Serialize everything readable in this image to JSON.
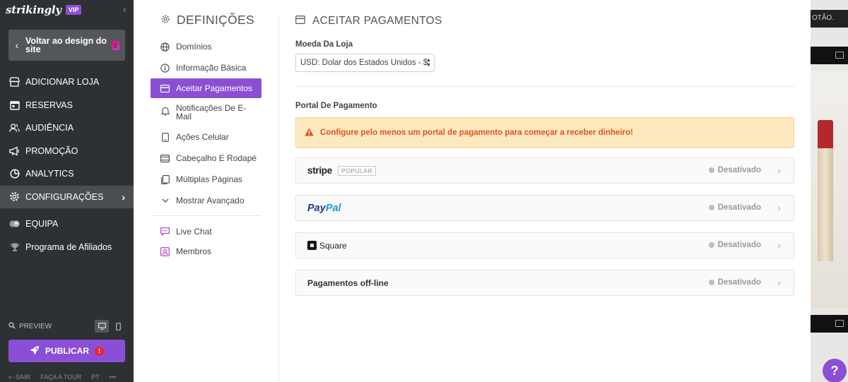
{
  "brand": {
    "logo_text": "strikingly",
    "badge": "VIP"
  },
  "sidebar": {
    "back_label": "Voltar ao design do site",
    "nav": [
      {
        "label": "ADICIONAR LOJA",
        "icon": "store-icon"
      },
      {
        "label": "RESERVAS",
        "icon": "calendar-icon"
      },
      {
        "label": "AUDIÊNCIA",
        "icon": "users-icon"
      },
      {
        "label": "PROMOÇÃO",
        "icon": "megaphone-icon"
      },
      {
        "label": "ANALYTICS",
        "icon": "pie-chart-icon"
      },
      {
        "label": "CONFIGURAÇÕES",
        "icon": "gear-icon"
      },
      {
        "label": "EQUIPA",
        "icon": "team-icon"
      },
      {
        "label": "Programa de Afiliados",
        "icon": "trophy-icon"
      }
    ],
    "preview_label": "PREVIEW",
    "publish_label": "PUBLICAR",
    "publish_alert": "!",
    "bottom_links": {
      "exit": "SAIR",
      "tour": "FAÇA A TOUR",
      "lang": "PT",
      "more": "•••"
    }
  },
  "settings": {
    "title": "DEFINIÇÕES",
    "items": [
      {
        "label": "Domínios",
        "icon": "globe-icon"
      },
      {
        "label": "Informação Básica",
        "icon": "info-icon"
      },
      {
        "label": "Aceitar Pagamentos",
        "icon": "card-icon"
      },
      {
        "label": "Notificações De E-Mail",
        "icon": "bell-icon"
      },
      {
        "label": "Ações Celular",
        "icon": "mobile-icon"
      },
      {
        "label": "Cabeçalho E Rodapé",
        "icon": "layout-icon"
      },
      {
        "label": "Múltiplas Páginas",
        "icon": "pages-icon"
      },
      {
        "label": "Mostrar Avançado",
        "icon": "chevron-down-icon"
      },
      {
        "label": "Live Chat",
        "icon": "chat-icon"
      },
      {
        "label": "Membros",
        "icon": "member-icon"
      }
    ]
  },
  "payments": {
    "title": "ACEITAR PAGAMENTOS",
    "currency_label": "Moeda Da Loja",
    "currency_value": "USD: Dolar dos Estados Unidos - $",
    "portal_label": "Portal De Pagamento",
    "alert": "Configure pelo menos um portal de pagamento para começar a receber dinheiro!",
    "gateways": {
      "stripe": {
        "name": "stripe",
        "tag": "POPULAR",
        "status": "Desativado"
      },
      "paypal": {
        "pay": "Pay",
        "pal": "Pal",
        "status": "Desativado"
      },
      "square": {
        "name": "Square",
        "status": "Desativado"
      },
      "offline": {
        "name": "Pagamentos off-line",
        "status": "Desativado"
      }
    }
  },
  "preview": {
    "top_text": "OTÃO."
  },
  "help": {
    "label": "?"
  },
  "colors": {
    "accent": "#8b4fd6",
    "sidebar": "#2e3134",
    "alert_bg": "#fde9c0",
    "alert_text": "#e0541e"
  }
}
